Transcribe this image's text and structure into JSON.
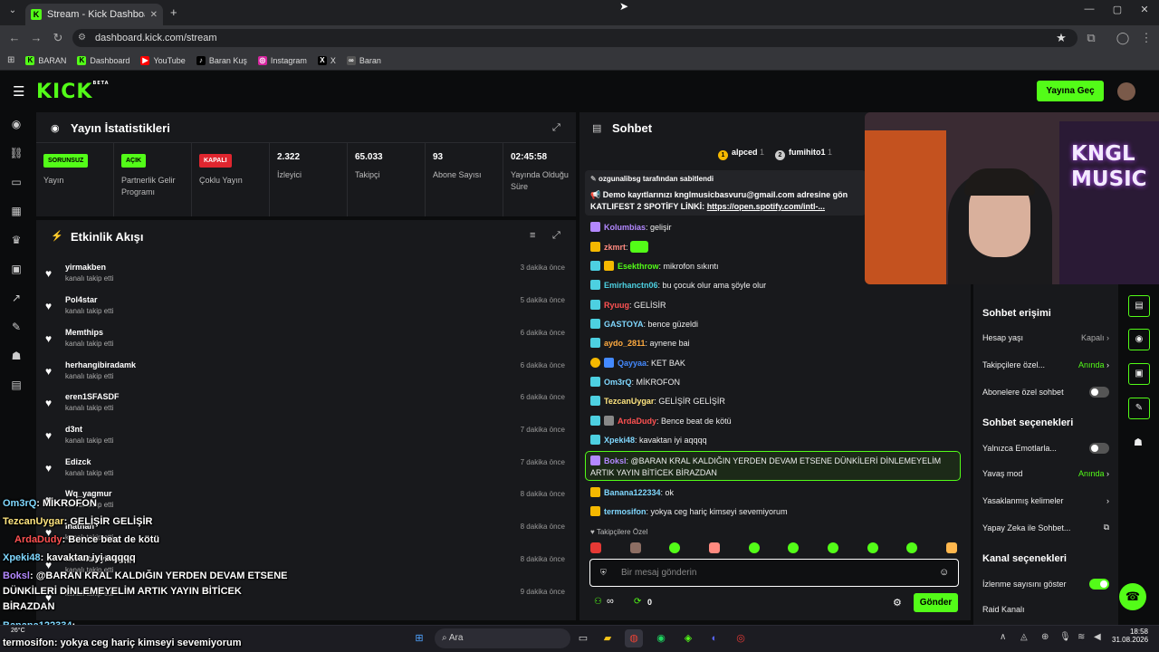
{
  "browser": {
    "tab_title": "Stream - Kick Dashboard",
    "url": "dashboard.kick.com/stream",
    "bookmarks": [
      {
        "label": "BARAN",
        "icon": "kick-icon"
      },
      {
        "label": "Dashboard",
        "icon": "kick-icon"
      },
      {
        "label": "YouTube",
        "icon": "youtube-icon"
      },
      {
        "label": "Baran Kuş",
        "icon": "tiktok-icon"
      },
      {
        "label": "Instagram",
        "icon": "instagram-icon"
      },
      {
        "label": "X",
        "icon": "x-icon"
      },
      {
        "label": "Baran",
        "icon": "link-icon"
      }
    ]
  },
  "header": {
    "logo": "KICK",
    "logo_beta": "BETA",
    "go_live": "Yayına Geç"
  },
  "stats": {
    "title": "Yayın İstatistikleri",
    "cells": [
      {
        "badge": "SORUNSUZ",
        "badge_color": "#53fc18",
        "label": "Yayın"
      },
      {
        "badge": "AÇIK",
        "badge_color": "#53fc18",
        "label": "Partnerlik Gelir Programı"
      },
      {
        "badge": "KAPALI",
        "badge_color": "#e0262f",
        "label": "Çoklu Yayın"
      },
      {
        "value": "2.322",
        "label": "İzleyici"
      },
      {
        "value": "65.033",
        "label": "Takipçi"
      },
      {
        "value": "93",
        "label": "Abone Sayısı"
      },
      {
        "value": "02:45:58",
        "label": "Yayında Olduğu Süre"
      }
    ]
  },
  "feed": {
    "title": "Etkinlik Akışı",
    "items": [
      {
        "name": "yirmakben",
        "sub": "kanalı takip etti",
        "time": "3 dakika önce"
      },
      {
        "name": "Pol4star",
        "sub": "kanalı takip etti",
        "time": "5 dakika önce"
      },
      {
        "name": "Memthips",
        "sub": "kanalı takip etti",
        "time": "6 dakika önce"
      },
      {
        "name": "herhangibiradamk",
        "sub": "kanalı takip etti",
        "time": "6 dakika önce"
      },
      {
        "name": "eren1SFASDF",
        "sub": "kanalı takip etti",
        "time": "6 dakika önce"
      },
      {
        "name": "d3nt",
        "sub": "kanalı takip etti",
        "time": "7 dakika önce"
      },
      {
        "name": "Edizck",
        "sub": "kanalı takip etti",
        "time": "7 dakika önce"
      },
      {
        "name": "Wq_yagmur",
        "sub": "kanalı takip etti",
        "time": "8 dakika önce"
      },
      {
        "name": "Inathan",
        "sub": "kanalı takip etti",
        "time": "8 dakika önce"
      },
      {
        "name": "kavaktanyiaqqqq",
        "sub": "kanalı takip etti",
        "time": "8 dakika önce"
      },
      {
        "name": "",
        "sub": "kanalı takip etti",
        "time": "9 dakika önce"
      }
    ]
  },
  "chat": {
    "title": "Sohbet",
    "top_gifters": [
      {
        "name": "alpced",
        "count": "1"
      },
      {
        "name": "fumihito1",
        "count": "1"
      }
    ],
    "pinned_by": "ozgunalibsg tarafından sabitlendi",
    "pinned_text_1": "Demo kayıtlarınızı knglmusicbasvuru@gmail.com adresine gön",
    "pinned_text_2": "KATLIFEST 2 SPOTİFY LİNKİ:",
    "pinned_link": "https://open.spotify.com/intl-...",
    "messages": [
      {
        "user": "Kolumbias",
        "color": "#b388ff",
        "text": ": gelişir"
      },
      {
        "user": "zkmrt",
        "color": "#ff8a80",
        "text": ":"
      },
      {
        "user": "Esekthrow",
        "color": "#53fc18",
        "text": ": mikrofon sıkıntı"
      },
      {
        "user": "Emirhanctn06",
        "color": "#4dd0e1",
        "text": ": bu çocuk olur ama şöyle olur"
      },
      {
        "user": "Ryuug",
        "color": "#ff5252",
        "text": ": GELİSİR"
      },
      {
        "user": "GASTOYA",
        "color": "#80d8ff",
        "text": ": bence güzeldi"
      },
      {
        "user": "aydo_2811",
        "color": "#ffab40",
        "text": ": aynene bai"
      },
      {
        "user": "Qayyaa",
        "color": "#448aff",
        "text": ": KET BAK"
      },
      {
        "user": "Om3rQ",
        "color": "#80d8ff",
        "text": ": MİKROFON"
      },
      {
        "user": "TezcanUygar",
        "color": "#ffe57f",
        "text": ": GELİŞİR GELİŞİR"
      },
      {
        "user": "ArdaDudy",
        "color": "#ff5252",
        "text": ": Bence beat de kötü"
      },
      {
        "user": "Xpeki48",
        "color": "#80d8ff",
        "text": ": kavaktan iyi aqqqq"
      }
    ],
    "highlight_user": "Boksl",
    "highlight_text_1": ": @BARAN KRAL KALDIĞIN YERDEN DEVAM ETSENE DÜNKİLERİ DİNLEMEYELİM",
    "highlight_text_2": "ARTIK YAYIN BİTİCEK BİRAZDAN",
    "messages2": [
      {
        "user": "Banana122334",
        "color": "#80d8ff",
        "text": ": ok"
      },
      {
        "user": "termosifon",
        "color": "#80d8ff",
        "text": ": yokya ceg hariç kimseyi sevemiyorum"
      }
    ],
    "followers_only": "Takipçilere Özel",
    "input_placeholder": "Bir mesaj gönderin",
    "infinity": "∞",
    "points": "0",
    "send": "Gönder"
  },
  "settings": {
    "access_title": "Sohbet erişimi",
    "age": {
      "label": "Hesap yaşı",
      "value": "Kapalı"
    },
    "followers": {
      "label": "Takipçilere özel...",
      "value": "Anında"
    },
    "subs": {
      "label": "Abonelere özel sohbet"
    },
    "options_title": "Sohbet seçenekleri",
    "emotes": {
      "label": "Yalnızca Emotlarla..."
    },
    "slow": {
      "label": "Yavaş mod",
      "value": "Anında"
    },
    "banned": {
      "label": "Yasaklanmış kelimeler"
    },
    "ai": {
      "label": "Yapay Zeka ile Sohbet..."
    },
    "channel_title": "Kanal seçenekleri",
    "viewcount": {
      "label": "İzlenme sayısını göster"
    },
    "raid": {
      "label": "Raid Kanalı"
    }
  },
  "webcam": {
    "sign": "KNGL MUSIC"
  },
  "overlay": [
    {
      "user": "Om3rQ",
      "color": "#80d8ff",
      "text": ": MİKROFON"
    },
    {
      "user": "TezcanUygar",
      "color": "#ffe57f",
      "text": ": GELİŞİR GELİŞİR"
    },
    {
      "user": "ArdaDudy",
      "color": "#ff5252",
      "text": ": Bence beat de kötü"
    },
    {
      "user": "Xpeki48",
      "color": "#80d8ff",
      "text": ": kavaktan iyi aqqqq"
    },
    {
      "user": "Boksl",
      "color": "#b388ff",
      "text": ": @BARAN KRAL KALDIĞIN YERDEN DEVAM ETSENE"
    },
    {
      "user": "",
      "color": "#fff",
      "text": "DÜNKİLERİ DİNLEMEYELİM ARTIK YAYIN BİTİCEK"
    },
    {
      "user": "",
      "color": "#fff",
      "text": "BİRAZDAN"
    },
    {
      "user": "Banana122334",
      "color": "#80d8ff",
      "text": ":"
    },
    {
      "user": "termosifon",
      "color": "#fff",
      "text": ": yokya ceg hariç kimseyi sevemiyorum"
    }
  ],
  "taskbar": {
    "search": "Ara",
    "weather": "26°C",
    "time": "18:58",
    "date": "31.08.2026"
  }
}
